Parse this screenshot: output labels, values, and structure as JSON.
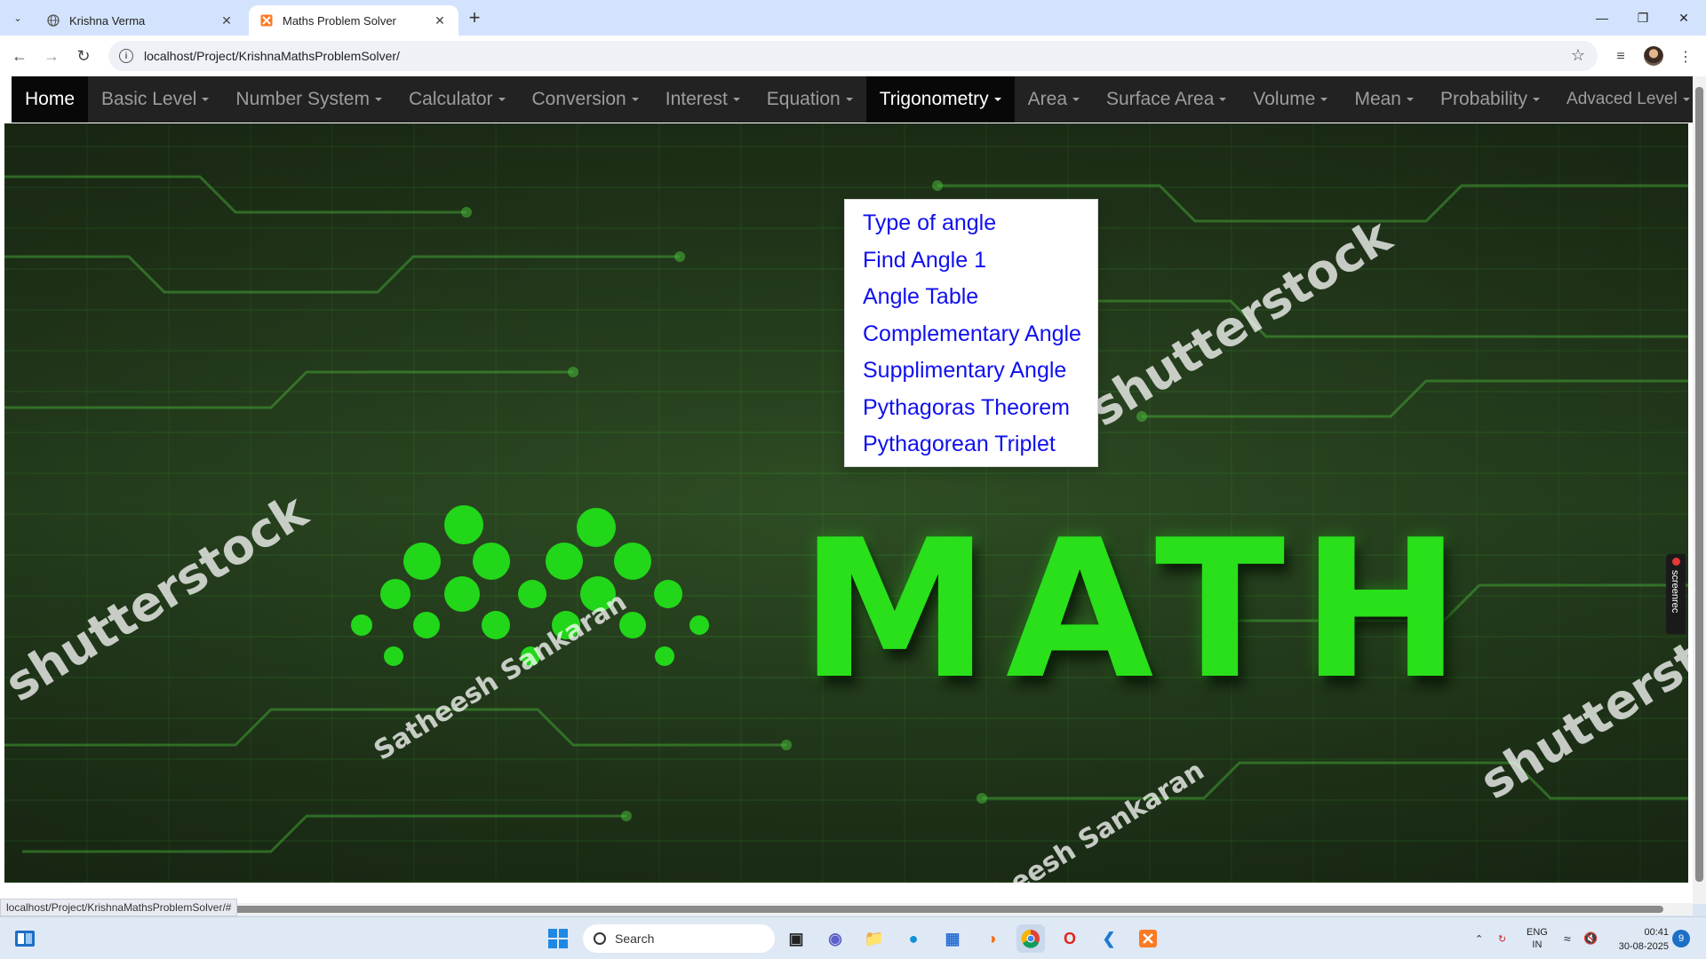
{
  "browser": {
    "tabs": [
      {
        "title": "Krishna Verma",
        "favicon": "globe-icon"
      },
      {
        "title": "Maths Problem Solver",
        "favicon": "xampp-icon"
      }
    ],
    "url": "localhost/Project/KrishnaMathsProblemSolver/",
    "status_url": "localhost/Project/KrishnaMathsProblemSolver/#"
  },
  "navbar": {
    "home": "Home",
    "items": [
      {
        "label": "Basic Level"
      },
      {
        "label": "Number System"
      },
      {
        "label": "Calculator"
      },
      {
        "label": "Conversion"
      },
      {
        "label": "Interest"
      },
      {
        "label": "Equation"
      },
      {
        "label": "Trigonometry"
      },
      {
        "label": "Area"
      },
      {
        "label": "Surface Area"
      },
      {
        "label": "Volume"
      },
      {
        "label": "Mean"
      },
      {
        "label": "Probability"
      },
      {
        "label": "Advaced Level"
      }
    ]
  },
  "dropdown": {
    "items": [
      "Type of angle",
      "Find Angle 1",
      "Angle Table",
      "Complementary Angle",
      "Supplimentary Angle",
      "Pythagoras Theorem",
      "Pythagorean Triplet"
    ],
    "link_color": "#1010ee"
  },
  "hero": {
    "title": "MATH",
    "watermark_brand": "shutterstock",
    "watermark_author": "Satheesh Sankaran",
    "accent": "#29e01a"
  },
  "screenrec_label": "screenrec",
  "taskbar": {
    "search_placeholder": "Search",
    "lang": "ENG",
    "region": "IN",
    "time": "00:41",
    "date": "30-08-2025",
    "notification_count": "9"
  },
  "colors": {
    "navbar_bg": "#222222",
    "navbar_active_bg": "#080808",
    "navbar_text": "#9d9d9d",
    "tabbar_bg": "#d3e3fd"
  }
}
